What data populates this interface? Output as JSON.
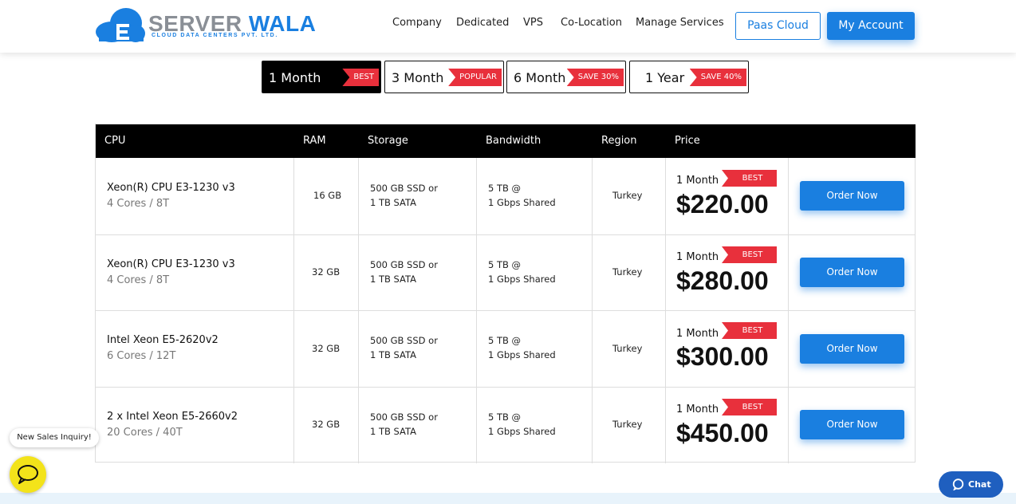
{
  "header": {
    "logo_name_part1": "SERVER",
    "logo_name_part2": "WALA",
    "logo_tagline": "CLOUD DATA CENTERS PVT. LTD.",
    "nav": [
      "Company",
      "Dedicated",
      "VPS",
      "Co-Location",
      "Manage Services"
    ],
    "paas_label": "Paas Cloud",
    "account_label": "My Account"
  },
  "tabs": [
    {
      "label": "1 Month",
      "badge": "BEST",
      "active": true
    },
    {
      "label": "3 Month",
      "badge": "POPULAR",
      "active": false
    },
    {
      "label": "6 Month",
      "badge": "SAVE 30%",
      "active": false
    },
    {
      "label": "1 Year",
      "badge": "SAVE 40%",
      "active": false
    }
  ],
  "table": {
    "columns": [
      "CPU",
      "RAM",
      "Storage",
      "Bandwidth",
      "Region",
      "Price"
    ],
    "rows": [
      {
        "cpu": "Xeon(R) CPU E3-1230 v3",
        "cores": "4 Cores / 8T",
        "ram": "16 GB",
        "storage_1": "500 GB SSD or",
        "storage_2": "1 TB SATA",
        "bandwidth_1": "5 TB @",
        "bandwidth_2": "1 Gbps Shared",
        "region": "Turkey",
        "period": "1 Month",
        "badge": "BEST",
        "price": "$220.00",
        "order": "Order Now"
      },
      {
        "cpu": "Xeon(R) CPU E3-1230 v3",
        "cores": "4 Cores / 8T",
        "ram": "32 GB",
        "storage_1": "500 GB SSD or",
        "storage_2": "1 TB SATA",
        "bandwidth_1": "5 TB @",
        "bandwidth_2": "1 Gbps Shared",
        "region": "Turkey",
        "period": "1 Month",
        "badge": "BEST",
        "price": "$280.00",
        "order": "Order Now"
      },
      {
        "cpu": "Intel Xeon E5-2620v2",
        "cores": "6 Cores / 12T",
        "ram": "32 GB",
        "storage_1": "500 GB SSD or",
        "storage_2": "1 TB SATA",
        "bandwidth_1": "5 TB @",
        "bandwidth_2": "1 Gbps Shared",
        "region": "Turkey",
        "period": "1 Month",
        "badge": "BEST",
        "price": "$300.00",
        "order": "Order Now"
      },
      {
        "cpu": "2 x Intel Xeon E5-2660v2",
        "cores": "20 Cores / 40T",
        "ram": "32 GB",
        "storage_1": "500 GB SSD or",
        "storage_2": "1 TB SATA",
        "bandwidth_1": "5 TB @",
        "bandwidth_2": "1 Gbps Shared",
        "region": "Turkey",
        "period": "1 Month",
        "badge": "BEST",
        "price": "$450.00",
        "order": "Order Now"
      }
    ]
  },
  "widgets": {
    "inquiry_label": "New Sales Inquiry!",
    "chat_label": "Chat"
  },
  "colors": {
    "brand_blue": "#1a7fe0",
    "badge_red": "#e8303c",
    "chat_yellow": "#f3e31a"
  }
}
